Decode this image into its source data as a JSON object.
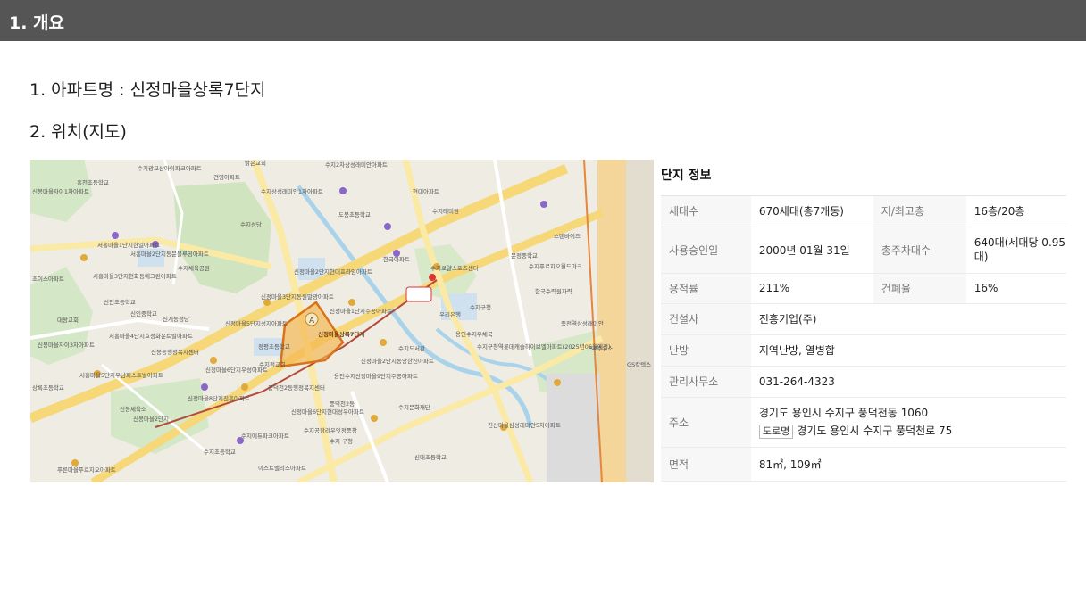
{
  "header": {
    "title": "1. 개요"
  },
  "items": {
    "apt_name": "1. 아파트명 : 신정마을상록7단지",
    "location": "2. 위치(지도)"
  },
  "map": {
    "labels": [
      "홍천초등학교",
      "신봉마을자이1차아파트",
      "서홍마을1단지한일아파트",
      "서홍마을2단지동문블루밍아파트",
      "서홍마을3단지현화동에그린아파트",
      "초이스아파트",
      "신인초등학교",
      "신인중학교",
      "대왕교회",
      "신봉마을자이3차아파트",
      "서홍마을4단지효성화운트빌아파트",
      "신봉동행정복지센터",
      "서홍마을5단지우남퍼스트빌아파트",
      "상록초등학교",
      "신봉체육소",
      "신봉마을2단지",
      "푸른마을푸르지오아파트",
      "수지광교산아이파크아파트",
      "밝은교회",
      "건영아파트",
      "수지2차상성래미안아파트",
      "수지상성래미안1차아파트",
      "수지성당",
      "수지체육공원",
      "신정마을2단지현대프라임아파트",
      "신정마을3단지동원말광아파트",
      "신정마을5단지성지아파트",
      "신계동성당",
      "신정마을6단지우성아파트",
      "신정마을8단지진흥아파트",
      "수지에듀파크아파트",
      "수지초등학교",
      "수지정교회",
      "풍덕천2동행정복지센터",
      "정평초등학교",
      "신정마을6단지현대성우아파트",
      "수지공항리우잇정풍창",
      "이스트밸리스아파트",
      "수지 구청",
      "신정마을1단지주공아파트",
      "용인수지신정마을9단지주공아파트",
      "풍덕천2동",
      "현대아파트",
      "도봉초등학교",
      "수지래미원",
      "한국아파트",
      "수지로얄스포츠센터",
      "수지구청",
      "용인수지우체국",
      "수지도서관",
      "우리은행",
      "문정중학교",
      "수지푸르지오월드마크",
      "한국수력원자력",
      "수지구청역롯데캐슬하이브엘아파트(2025년06월예정)",
      "신정마을2단지동양한신아파트",
      "수지문화재단",
      "진산마을삼성래미안5차아파트",
      "SK주유소",
      "GS칼텍스",
      "죽전역삼성래미안",
      "신대초등학교",
      "스탠바이즈"
    ],
    "marker_labels": [
      "신정마을상록7단지"
    ]
  },
  "info": {
    "title": "단지 정보",
    "rows": {
      "households_label": "세대수",
      "households_value": "670세대(총7개동)",
      "floors_label": "저/최고층",
      "floors_value": "16층/20층",
      "approval_label": "사용승인일",
      "approval_value": "2000년 01월 31일",
      "parking_label": "총주차대수",
      "parking_value": "640대(세대당 0.95대)",
      "far_label": "용적률",
      "far_value": "211%",
      "bcr_label": "건폐율",
      "bcr_value": "16%",
      "builder_label": "건설사",
      "builder_value": "진흥기업(주)",
      "heating_label": "난방",
      "heating_value": "지역난방, 열병합",
      "office_label": "관리사무소",
      "office_value": "031-264-4323",
      "address_label": "주소",
      "address_jibun": "경기도 용인시 수지구 풍덕천동 1060",
      "road_tag": "도로명",
      "address_road": "경기도 용인시 수지구 풍덕천로 75",
      "area_label": "면적",
      "area_value": "81㎡, 109㎡"
    }
  }
}
